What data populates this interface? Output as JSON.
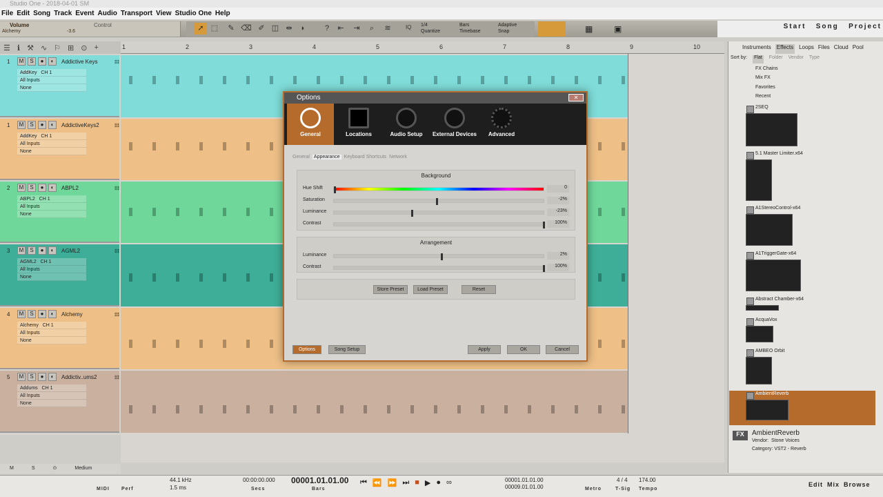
{
  "window": {
    "title": "Studio One - 2018-04-01 SM"
  },
  "menu": [
    "File",
    "Edit",
    "Song",
    "Track",
    "Event",
    "Audio",
    "Transport",
    "View",
    "Studio One",
    "Help"
  ],
  "inspector": {
    "param": "Volume",
    "control": "Control",
    "instrument": "Alchemy",
    "value": "-3.6"
  },
  "toolbar": {
    "quantize_value": "1/4",
    "quantize_label": "Quantize",
    "timebase_value": "Bars",
    "timebase_label": "Timebase",
    "snap_value": "Adaptive",
    "snap_label": "Snap",
    "iq": "IQ"
  },
  "top_right": {
    "start": "Start",
    "song": "Song",
    "project": "Project"
  },
  "ruler": [
    "1",
    "2",
    "3",
    "4",
    "5",
    "6",
    "7",
    "8",
    "9",
    "10"
  ],
  "tracks": [
    {
      "num": "1",
      "name": "Addictive Keys",
      "inst": "AddKey",
      "ch": "CH 1",
      "input": "All Inputs",
      "out": "None",
      "color": "#7fdcd8"
    },
    {
      "num": "1",
      "name": "AddictiveKeys2",
      "inst": "AddKey",
      "ch": "CH 1",
      "input": "All Inputs",
      "out": "None",
      "color": "#eec087"
    },
    {
      "num": "2",
      "name": "ABPL2",
      "inst": "ABPL2",
      "ch": "CH 1",
      "input": "All Inputs",
      "out": "None",
      "color": "#6fd79a"
    },
    {
      "num": "3",
      "name": "AGML2",
      "inst": "AGML2",
      "ch": "CH 1",
      "input": "All Inputs",
      "out": "None",
      "color": "#3fae98"
    },
    {
      "num": "4",
      "name": "Alchemy",
      "inst": "Alchemy",
      "ch": "CH 1",
      "input": "All Inputs",
      "out": "None",
      "color": "#eec087"
    },
    {
      "num": "5",
      "name": "Addictiv..ums2",
      "inst": "Addums",
      "ch": "CH 1",
      "input": "All Inputs",
      "out": "None",
      "color": "#c9b09f"
    }
  ],
  "track_buttons": {
    "m": "M",
    "s": "S"
  },
  "bottom_left": {
    "m": "M",
    "s": "S",
    "medium": "Medium"
  },
  "browser": {
    "tabs": [
      "Instruments",
      "Effects",
      "Loops",
      "Files",
      "Cloud",
      "Pool"
    ],
    "sort_label": "Sort by:",
    "sort": [
      "Flat",
      "Folder",
      "Vendor",
      "Type"
    ],
    "categories": [
      "FX Chains",
      "Mix FX",
      "Favorites",
      "Recent"
    ],
    "items": [
      "2SEQ",
      "5.1 Master Limiter.x64",
      "A1StereoControl-x64",
      "A1TriggerGate-x64",
      "Abstract Chamber-x64",
      "AcquaVox",
      "AMBEO Orbit",
      "AmbientReverb"
    ],
    "info": {
      "fx_badge": "FX",
      "name": "AmbientReverb",
      "vendor_label": "Vendor:",
      "vendor": "Stone Voices",
      "category_label": "Category:",
      "category": "VST2 - Reverb"
    }
  },
  "transport": {
    "midi": "MIDI",
    "perf": "Perf",
    "rate": "44.1 kHz",
    "latency": "1.5 ms",
    "secs_value": "00:00:00.000",
    "secs_label": "Secs",
    "bars_value": "00001.01.01.00",
    "bars_label": "Bars",
    "loop_l": "00001.01.01.00",
    "loop_r": "00009.01.01.00",
    "metro": "Metro",
    "tsig_value": "4 / 4",
    "tsig": "T-Sig",
    "tempo_value": "174.00",
    "tempo": "Tempo",
    "edit": "Edit",
    "mix": "Mix",
    "browse": "Browse"
  },
  "dialog": {
    "title": "Options",
    "icons": [
      "General",
      "Locations",
      "Audio Setup",
      "External Devices",
      "Advanced"
    ],
    "subtabs": [
      "General",
      "Appearance",
      "Keyboard Shortcuts",
      "Network"
    ],
    "background": {
      "title": "Background",
      "params": [
        {
          "label": "Hue Shift",
          "value": "0",
          "pos": 0.0
        },
        {
          "label": "Saturation",
          "value": "-2%",
          "pos": 0.49
        },
        {
          "label": "Luminance",
          "value": "-23%",
          "pos": 0.37
        },
        {
          "label": "Contrast",
          "value": "100%",
          "pos": 1.0
        }
      ]
    },
    "arrangement": {
      "title": "Arrangement",
      "params": [
        {
          "label": "Luminance",
          "value": "2%",
          "pos": 0.51
        },
        {
          "label": "Contrast",
          "value": "100%",
          "pos": 1.0
        }
      ]
    },
    "preset_buttons": [
      "Store Preset",
      "Load Preset",
      "Reset"
    ],
    "footer": {
      "options": "Options",
      "song_setup": "Song Setup",
      "apply": "Apply",
      "ok": "OK",
      "cancel": "Cancel"
    }
  }
}
